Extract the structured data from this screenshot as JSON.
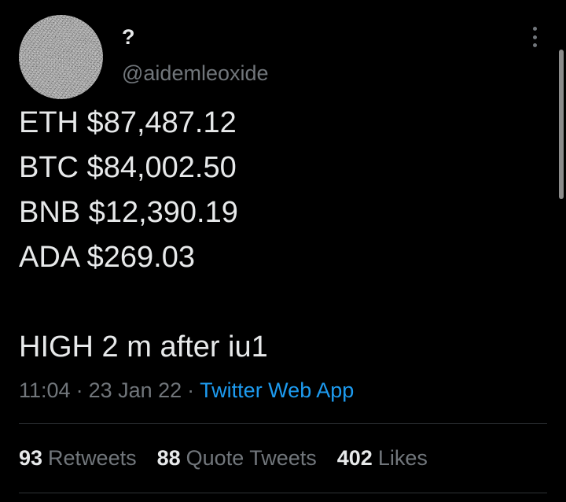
{
  "author": {
    "display_name": "?",
    "username": "@aidemleoxide"
  },
  "tweet": {
    "lines": [
      "ETH $87,487.12",
      "BTC $84,002.50",
      "BNB $12,390.19",
      "ADA $269.03",
      "",
      "HIGH 2 m after iu1"
    ]
  },
  "meta": {
    "time": "11:04",
    "date": "23 Jan 22",
    "separator": "·",
    "source": "Twitter Web App"
  },
  "stats": {
    "retweets": {
      "count": "93",
      "label": "Retweets"
    },
    "quote_tweets": {
      "count": "88",
      "label": "Quote Tweets"
    },
    "likes": {
      "count": "402",
      "label": "Likes"
    }
  },
  "icons": {
    "more": "more-vertical-icon"
  },
  "colors": {
    "background": "#000000",
    "primary_text": "#e7e9ea",
    "secondary_text": "#71767b",
    "link": "#1d9bf0",
    "divider": "#2f3336"
  }
}
